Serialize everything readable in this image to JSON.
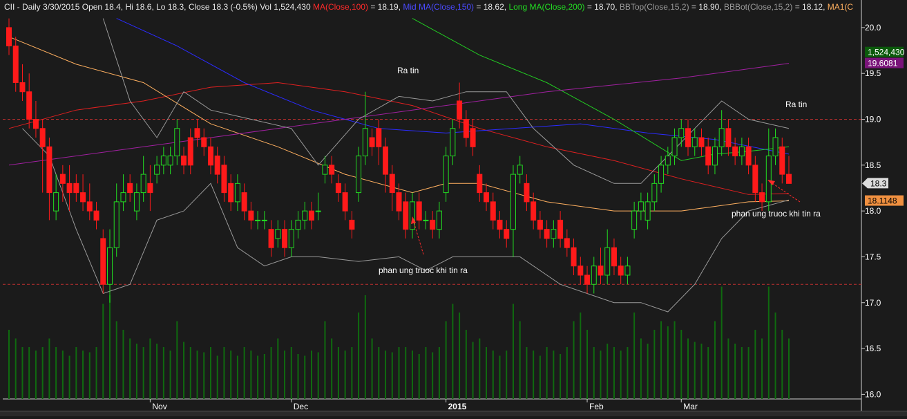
{
  "header": {
    "symbol": "CII",
    "info": " - Daily 3/30/2015 Open 18.4, Hi 18.6, Lo 18.3, Close 18.3 (-0.5%) Vol 1,524,430 ",
    "ma100_label": "MA(Close,100)",
    "ma100_value": " = 18.19, ",
    "mid_label": "Mid MA(Close,150)",
    "mid_value": " = 18.62, ",
    "long_label": "Long MA(Close,200)",
    "long_value": " = 18.70, ",
    "bbtop_label": "BBTop(Close,15,2)",
    "bbtop_value": " = 18.90, ",
    "bbbot_label": "BBBot(Close,15,2)",
    "bbbot_value": " = 18.12, ",
    "ma1_label": "MA1(C"
  },
  "colors": {
    "background": "#1b1b1b",
    "up": "#22dd22",
    "down": "#ff1a1a",
    "ma100": "#e02020",
    "mid": "#2b2bff",
    "long": "#22cc22",
    "ma1": "#ffb060",
    "purple": "#a020a0",
    "bb": "#9a9a9a",
    "volume": "#0f6a0f",
    "hline": "#c03030"
  },
  "axis": {
    "y_ticks": [
      "20.0",
      "19.5",
      "19.0",
      "18.5",
      "18.0",
      "17.5",
      "17.0",
      "16.5",
      "16.0"
    ],
    "y_tick_values": [
      20.0,
      19.5,
      19.0,
      18.5,
      18.0,
      17.5,
      17.0,
      16.5,
      16.0
    ],
    "x_labels": [
      {
        "label": "Nov",
        "idx": 21
      },
      {
        "label": "Dec",
        "idx": 42
      },
      {
        "label": "2015",
        "idx": 65
      },
      {
        "label": "Feb",
        "idx": 86
      },
      {
        "label": "Mar",
        "idx": 100
      }
    ]
  },
  "badges": {
    "volume": "1,524,430",
    "purple": "19.6081",
    "close": "18.3",
    "ma1": "18.1148"
  },
  "annotations": {
    "ra_tin_1": "Ra tin",
    "ra_tin_2": "Ra tin",
    "phan_ung_1": "phan ung truoc khi tin ra",
    "phan_ung_2": "phan ung truoc khi tin ra"
  },
  "chart_data": {
    "type": "candlestick",
    "y_range": [
      15.95,
      20.15
    ],
    "horizontal_lines": [
      19.0,
      17.2
    ],
    "candles": [
      [
        20.0,
        19.8,
        20.1,
        19.7
      ],
      [
        19.8,
        19.4,
        19.9,
        19.3
      ],
      [
        19.4,
        19.3,
        19.6,
        19.2
      ],
      [
        19.3,
        19.0,
        19.5,
        18.9
      ],
      [
        19.0,
        18.9,
        19.2,
        18.8
      ],
      [
        18.9,
        18.7,
        19.0,
        18.2
      ],
      [
        18.7,
        18.2,
        18.8,
        17.9
      ],
      [
        18.0,
        18.2,
        18.4,
        17.9
      ],
      [
        18.4,
        18.3,
        18.5,
        18.1
      ],
      [
        18.3,
        18.2,
        18.5,
        18.0
      ],
      [
        18.3,
        18.2,
        18.4,
        18.1
      ],
      [
        18.2,
        18.1,
        18.4,
        18.0
      ],
      [
        18.1,
        18.0,
        18.3,
        17.9
      ],
      [
        18.0,
        17.9,
        18.1,
        17.8
      ],
      [
        17.7,
        17.2,
        17.8,
        17.1
      ],
      [
        17.2,
        17.6,
        17.8,
        17.0
      ],
      [
        17.6,
        18.1,
        18.3,
        17.5
      ],
      [
        18.1,
        18.2,
        18.4,
        18.0
      ],
      [
        18.3,
        18.2,
        18.4,
        18.1
      ],
      [
        18.0,
        18.2,
        18.3,
        17.9
      ],
      [
        18.2,
        18.4,
        18.6,
        18.1
      ],
      [
        18.3,
        18.2,
        18.5,
        18.0
      ],
      [
        18.4,
        18.5,
        18.6,
        18.3
      ],
      [
        18.5,
        18.6,
        18.7,
        18.4
      ],
      [
        18.5,
        18.6,
        18.7,
        18.4
      ],
      [
        18.6,
        18.9,
        19.0,
        18.5
      ],
      [
        18.6,
        18.5,
        18.7,
        18.4
      ],
      [
        18.8,
        18.5,
        18.9,
        18.4
      ],
      [
        18.9,
        18.8,
        19.0,
        18.7
      ],
      [
        18.8,
        18.7,
        18.9,
        18.6
      ],
      [
        18.7,
        18.5,
        18.8,
        18.4
      ],
      [
        18.6,
        18.4,
        18.7,
        18.3
      ],
      [
        18.5,
        18.2,
        18.6,
        18.1
      ],
      [
        18.3,
        18.1,
        18.4,
        18.0
      ],
      [
        18.1,
        18.3,
        18.4,
        18.0
      ],
      [
        18.2,
        18.0,
        18.3,
        17.9
      ],
      [
        18.0,
        17.9,
        18.1,
        17.8
      ],
      [
        17.9,
        17.9,
        18.0,
        17.8
      ],
      [
        17.9,
        17.9,
        18.0,
        17.8
      ],
      [
        17.8,
        17.6,
        17.9,
        17.5
      ],
      [
        17.7,
        17.8,
        17.9,
        17.6
      ],
      [
        17.8,
        17.6,
        17.9,
        17.5
      ],
      [
        17.6,
        17.8,
        17.9,
        17.5
      ],
      [
        17.8,
        17.9,
        18.0,
        17.7
      ],
      [
        17.9,
        18.0,
        18.1,
        17.8
      ],
      [
        18.0,
        17.9,
        18.1,
        17.8
      ],
      [
        18.0,
        18.0,
        18.2,
        17.9
      ],
      [
        18.4,
        18.5,
        18.6,
        18.3
      ],
      [
        18.5,
        18.4,
        18.6,
        18.3
      ],
      [
        18.3,
        18.2,
        18.4,
        18.1
      ],
      [
        18.2,
        18.0,
        18.3,
        17.9
      ],
      [
        17.9,
        17.8,
        18.0,
        17.7
      ],
      [
        18.2,
        18.6,
        18.7,
        18.1
      ],
      [
        18.6,
        18.9,
        19.3,
        18.5
      ],
      [
        18.8,
        18.7,
        18.9,
        18.6
      ],
      [
        18.9,
        18.7,
        19.0,
        18.5
      ],
      [
        18.7,
        18.4,
        18.8,
        18.2
      ],
      [
        18.4,
        18.2,
        18.5,
        18.0
      ],
      [
        18.2,
        18.0,
        18.3,
        17.9
      ],
      [
        18.1,
        17.8,
        18.2,
        17.7
      ],
      [
        17.8,
        18.1,
        18.2,
        17.7
      ],
      [
        18.1,
        17.9,
        18.2,
        17.8
      ],
      [
        17.9,
        17.9,
        18.0,
        17.8
      ],
      [
        17.9,
        17.8,
        18.0,
        17.7
      ],
      [
        17.8,
        18.0,
        18.1,
        17.7
      ],
      [
        18.2,
        18.6,
        18.7,
        18.1
      ],
      [
        18.6,
        18.9,
        19.0,
        18.5
      ],
      [
        19.2,
        19.0,
        19.4,
        18.9
      ],
      [
        19.0,
        18.8,
        19.1,
        18.7
      ],
      [
        18.9,
        18.7,
        19.0,
        18.6
      ],
      [
        18.4,
        18.2,
        18.5,
        18.1
      ],
      [
        18.2,
        18.1,
        18.3,
        18.0
      ],
      [
        18.1,
        17.9,
        18.2,
        17.8
      ],
      [
        17.9,
        17.8,
        18.0,
        17.7
      ],
      [
        17.8,
        17.7,
        17.9,
        17.6
      ],
      [
        17.8,
        18.4,
        18.5,
        17.5
      ],
      [
        18.4,
        18.5,
        18.6,
        18.3
      ],
      [
        18.3,
        18.1,
        18.4,
        18.0
      ],
      [
        18.1,
        17.9,
        18.2,
        17.8
      ],
      [
        17.9,
        17.8,
        18.0,
        17.7
      ],
      [
        17.8,
        17.7,
        17.9,
        17.6
      ],
      [
        17.7,
        17.8,
        17.9,
        17.6
      ],
      [
        17.9,
        17.7,
        18.0,
        17.6
      ],
      [
        17.7,
        17.6,
        17.8,
        17.5
      ],
      [
        17.6,
        17.4,
        17.7,
        17.3
      ],
      [
        17.4,
        17.3,
        17.5,
        17.2
      ],
      [
        17.3,
        17.2,
        17.4,
        17.1
      ],
      [
        17.2,
        17.4,
        17.5,
        17.1
      ],
      [
        17.4,
        17.3,
        17.6,
        17.2
      ],
      [
        17.3,
        17.6,
        17.8,
        17.2
      ],
      [
        17.6,
        17.4,
        17.7,
        17.3
      ],
      [
        17.4,
        17.3,
        17.5,
        17.2
      ],
      [
        17.3,
        17.4,
        17.5,
        17.2
      ],
      [
        17.8,
        18.0,
        18.1,
        17.7
      ],
      [
        18.0,
        18.1,
        18.2,
        17.9
      ],
      [
        17.9,
        18.1,
        18.2,
        17.8
      ],
      [
        18.1,
        18.3,
        18.4,
        18.0
      ],
      [
        18.3,
        18.5,
        18.6,
        18.2
      ],
      [
        18.5,
        18.6,
        18.7,
        18.4
      ],
      [
        18.6,
        18.8,
        18.9,
        18.5
      ],
      [
        18.8,
        18.9,
        19.0,
        18.7
      ],
      [
        18.9,
        18.7,
        19.0,
        18.6
      ],
      [
        18.7,
        18.8,
        18.9,
        18.6
      ],
      [
        18.8,
        18.7,
        18.9,
        18.6
      ],
      [
        18.7,
        18.5,
        18.8,
        18.4
      ],
      [
        18.5,
        18.7,
        18.8,
        18.4
      ],
      [
        18.7,
        18.9,
        19.1,
        18.6
      ],
      [
        18.9,
        18.7,
        19.0,
        18.6
      ],
      [
        18.7,
        18.6,
        18.8,
        18.5
      ],
      [
        18.6,
        18.7,
        18.8,
        18.5
      ],
      [
        18.7,
        18.5,
        18.8,
        18.4
      ],
      [
        18.5,
        18.2,
        18.6,
        18.1
      ],
      [
        18.2,
        18.1,
        18.3,
        18.0
      ],
      [
        18.1,
        18.6,
        18.9,
        18.0
      ],
      [
        18.6,
        18.8,
        18.9,
        18.5
      ],
      [
        18.7,
        18.4,
        18.8,
        18.3
      ],
      [
        18.4,
        18.3,
        18.6,
        18.3
      ]
    ],
    "volume": [
      0.4,
      0.35,
      0.3,
      0.3,
      0.28,
      0.3,
      0.35,
      0.3,
      0.28,
      0.25,
      0.3,
      0.28,
      0.27,
      0.3,
      0.55,
      0.6,
      0.45,
      0.4,
      0.35,
      0.32,
      0.3,
      0.35,
      0.32,
      0.3,
      0.28,
      0.45,
      0.33,
      0.3,
      0.28,
      0.27,
      0.3,
      0.25,
      0.3,
      0.28,
      0.25,
      0.3,
      0.28,
      0.25,
      0.26,
      0.3,
      0.35,
      0.28,
      0.3,
      0.26,
      0.25,
      0.28,
      0.27,
      0.45,
      0.35,
      0.3,
      0.28,
      0.3,
      0.5,
      0.6,
      0.35,
      0.3,
      0.28,
      0.27,
      0.3,
      0.3,
      0.28,
      0.26,
      0.3,
      0.27,
      0.3,
      0.45,
      0.55,
      0.5,
      0.4,
      0.33,
      0.35,
      0.3,
      0.28,
      0.25,
      0.28,
      0.55,
      0.45,
      0.3,
      0.28,
      0.25,
      0.3,
      0.28,
      0.26,
      0.3,
      0.45,
      0.5,
      0.4,
      0.3,
      0.28,
      0.32,
      0.3,
      0.28,
      0.3,
      0.5,
      0.35,
      0.32,
      0.4,
      0.45,
      0.42,
      0.45,
      0.4,
      0.35,
      0.33,
      0.32,
      0.3,
      0.45,
      0.65,
      0.35,
      0.32,
      0.3,
      0.3,
      0.4,
      0.35,
      0.65,
      0.5,
      0.4,
      0.35
    ],
    "series": [
      {
        "name": "MA(Close,100)",
        "points": [
          [
            0,
            18.9
          ],
          [
            10,
            19.1
          ],
          [
            20,
            19.2
          ],
          [
            30,
            19.35
          ],
          [
            40,
            19.4
          ],
          [
            50,
            19.3
          ],
          [
            60,
            19.15
          ],
          [
            70,
            18.9
          ],
          [
            80,
            18.7
          ],
          [
            90,
            18.55
          ],
          [
            100,
            18.35
          ],
          [
            110,
            18.18
          ],
          [
            116,
            18.19
          ]
        ]
      },
      {
        "name": "Mid MA(Close,150)",
        "points": [
          [
            16,
            20.1
          ],
          [
            25,
            19.8
          ],
          [
            35,
            19.4
          ],
          [
            45,
            19.1
          ],
          [
            55,
            18.9
          ],
          [
            65,
            18.85
          ],
          [
            75,
            18.9
          ],
          [
            85,
            18.95
          ],
          [
            95,
            18.85
          ],
          [
            105,
            18.78
          ],
          [
            116,
            18.62
          ]
        ]
      },
      {
        "name": "Long MA(Close,200)",
        "points": [
          [
            60,
            20.1
          ],
          [
            70,
            19.7
          ],
          [
            80,
            19.4
          ],
          [
            90,
            19.0
          ],
          [
            100,
            18.55
          ],
          [
            105,
            18.62
          ],
          [
            110,
            18.65
          ],
          [
            116,
            18.7
          ]
        ]
      },
      {
        "name": "MA1",
        "points": [
          [
            0,
            19.9
          ],
          [
            10,
            19.6
          ],
          [
            20,
            19.4
          ],
          [
            30,
            18.95
          ],
          [
            40,
            18.7
          ],
          [
            50,
            18.4
          ],
          [
            60,
            18.2
          ],
          [
            65,
            18.3
          ],
          [
            70,
            18.3
          ],
          [
            80,
            18.1
          ],
          [
            90,
            18.0
          ],
          [
            100,
            18.0
          ],
          [
            110,
            18.1
          ],
          [
            116,
            18.11
          ]
        ]
      },
      {
        "name": "19.6081",
        "points": [
          [
            0,
            18.5
          ],
          [
            20,
            18.7
          ],
          [
            40,
            18.9
          ],
          [
            60,
            19.1
          ],
          [
            80,
            19.3
          ],
          [
            100,
            19.45
          ],
          [
            116,
            19.61
          ]
        ]
      },
      {
        "name": "BBTop(Close,15,2)",
        "points": [
          [
            14,
            20.1
          ],
          [
            18,
            19.2
          ],
          [
            22,
            18.8
          ],
          [
            26,
            19.3
          ],
          [
            30,
            19.1
          ],
          [
            36,
            19.0
          ],
          [
            42,
            18.9
          ],
          [
            46,
            18.5
          ],
          [
            52,
            19.0
          ],
          [
            58,
            19.25
          ],
          [
            63,
            19.2
          ],
          [
            68,
            19.3
          ],
          [
            74,
            19.3
          ],
          [
            78,
            18.9
          ],
          [
            84,
            18.5
          ],
          [
            90,
            18.3
          ],
          [
            94,
            18.3
          ],
          [
            98,
            18.6
          ],
          [
            102,
            18.9
          ],
          [
            106,
            19.2
          ],
          [
            110,
            19.0
          ],
          [
            116,
            18.9
          ]
        ]
      },
      {
        "name": "BBBot(Close,15,2)",
        "points": [
          [
            2,
            18.9
          ],
          [
            6,
            18.6
          ],
          [
            10,
            17.8
          ],
          [
            14,
            17.1
          ],
          [
            18,
            17.2
          ],
          [
            22,
            17.9
          ],
          [
            26,
            18.0
          ],
          [
            30,
            18.3
          ],
          [
            34,
            17.6
          ],
          [
            38,
            17.4
          ],
          [
            42,
            17.5
          ],
          [
            46,
            17.5
          ],
          [
            52,
            17.45
          ],
          [
            58,
            17.5
          ],
          [
            62,
            17.35
          ],
          [
            66,
            17.5
          ],
          [
            70,
            17.5
          ],
          [
            76,
            17.5
          ],
          [
            82,
            17.2
          ],
          [
            86,
            17.1
          ],
          [
            90,
            17.0
          ],
          [
            94,
            17.0
          ],
          [
            98,
            16.9
          ],
          [
            102,
            17.2
          ],
          [
            106,
            17.7
          ],
          [
            110,
            18.0
          ],
          [
            116,
            18.12
          ]
        ]
      }
    ]
  }
}
